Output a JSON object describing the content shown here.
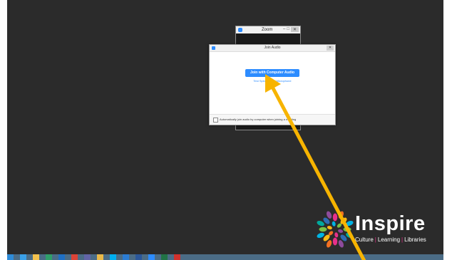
{
  "zoom_window": {
    "title": "Zoom",
    "minimize": "–",
    "maximize": "□",
    "close": "✕"
  },
  "dialog": {
    "title": "Join Audio",
    "close": "✕",
    "join_button": "Join with Computer Audio",
    "test_link": "Test Speaker and Microphone",
    "auto_join_label": "Automatically join audio by computer when joining a meeting"
  },
  "logo": {
    "word": "Inspire",
    "tagline": [
      "Culture",
      "Learning",
      "Libraries"
    ],
    "separator": "|",
    "colors": [
      "#7ac143",
      "#00a99d",
      "#2e6db4",
      "#8e4b9c",
      "#e8308a",
      "#f37021",
      "#fdb913",
      "#00b3e3"
    ]
  },
  "taskbar": {
    "icons": [
      {
        "name": "start-icon",
        "color": "#2e8bd8"
      },
      {
        "name": "internet-explorer-icon",
        "color": "#3aa0e8"
      },
      {
        "name": "file-explorer-icon",
        "color": "#f2c14e"
      },
      {
        "name": "app-icon",
        "color": "#2f9f6a"
      },
      {
        "name": "outlook-icon",
        "color": "#1f6fc4"
      },
      {
        "name": "chrome-icon",
        "color": "#db4437"
      },
      {
        "name": "teams-icon",
        "color": "#6264a7"
      },
      {
        "name": "folder-icon",
        "color": "#e9b949"
      },
      {
        "name": "skype-icon",
        "color": "#00aff0"
      },
      {
        "name": "app-icon-2",
        "color": "#2b7cd3"
      },
      {
        "name": "word-icon",
        "color": "#2b579a"
      },
      {
        "name": "zoom-icon",
        "color": "#2d8cff"
      },
      {
        "name": "excel-icon",
        "color": "#217346"
      },
      {
        "name": "acrobat-icon",
        "color": "#d0312d"
      }
    ]
  },
  "annotation": {
    "color": "#f7b400"
  }
}
